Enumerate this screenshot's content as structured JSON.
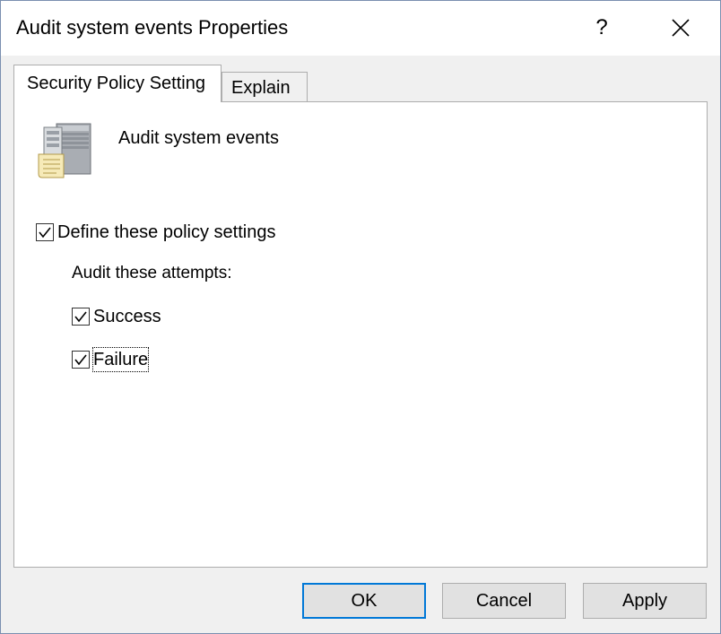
{
  "window": {
    "title": "Audit system events Properties",
    "help_glyph": "?",
    "close_icon": "close-icon"
  },
  "tabs": [
    {
      "label": "Security Policy Setting",
      "selected": true
    },
    {
      "label": "Explain",
      "selected": false
    }
  ],
  "policy": {
    "name": "Audit system events",
    "icon": "server-policy-icon"
  },
  "settings": {
    "define_label": "Define these policy settings",
    "define_checked": true,
    "audit_label": "Audit these attempts:",
    "success_label": "Success",
    "success_checked": true,
    "failure_label": "Failure",
    "failure_checked": true
  },
  "buttons": {
    "ok_label": "OK",
    "cancel_label": "Cancel",
    "apply_label": "Apply"
  },
  "colors": {
    "accent": "#0078d7",
    "button_bg": "#e1e1e1",
    "dialog_bg": "#f0f0f0"
  }
}
